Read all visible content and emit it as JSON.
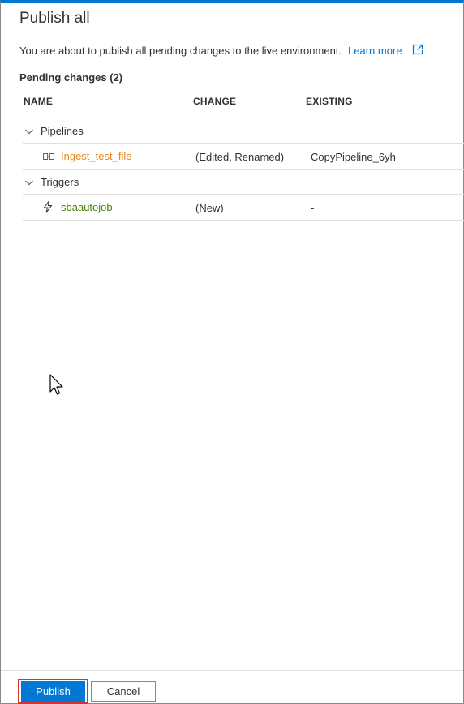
{
  "dialog": {
    "title": "Publish all",
    "description": "You are about to publish all pending changes to the live environment.",
    "learn_more": "Learn more",
    "pending_label": "Pending changes (2)"
  },
  "table": {
    "headers": {
      "name": "NAME",
      "change": "CHANGE",
      "existing": "EXISTING"
    },
    "groups": [
      {
        "label": "Pipelines",
        "rows": [
          {
            "name": "Ingest_test_file",
            "change": "(Edited, Renamed)",
            "existing": "CopyPipeline_6yh",
            "icon": "pipeline-icon"
          }
        ]
      },
      {
        "label": "Triggers",
        "rows": [
          {
            "name": "sbaautojob",
            "change": "(New)",
            "existing": "-",
            "icon": "trigger-icon"
          }
        ]
      }
    ]
  },
  "footer": {
    "publish_label": "Publish",
    "cancel_label": "Cancel"
  },
  "colors": {
    "accent": "#0078d4",
    "pipeline": "#e8871e",
    "trigger": "#498205",
    "highlight": "#d13438"
  }
}
